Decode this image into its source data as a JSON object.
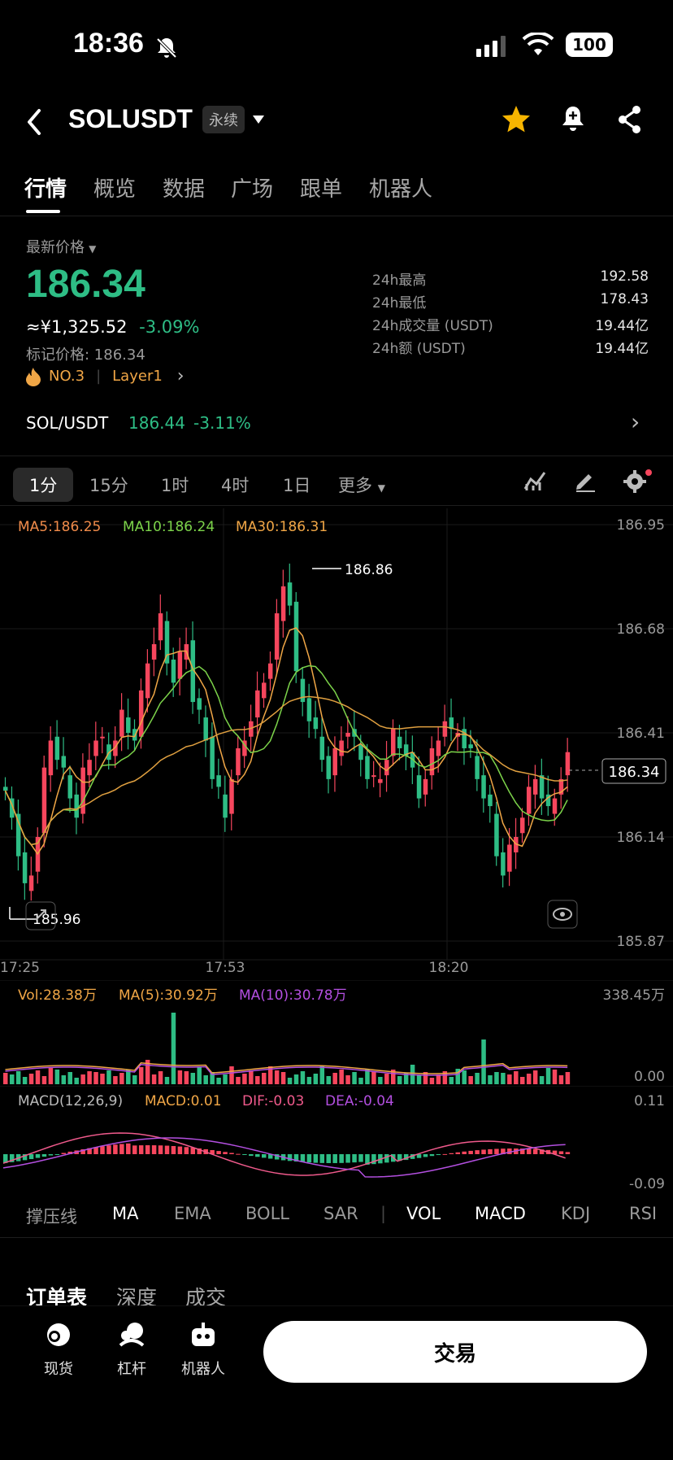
{
  "status_bar": {
    "time": "18:36",
    "battery": "100"
  },
  "header": {
    "symbol": "SOLUSDT",
    "contract_type": "永续"
  },
  "tabs": [
    {
      "label": "行情",
      "active": true
    },
    {
      "label": "概览",
      "active": false
    },
    {
      "label": "数据",
      "active": false
    },
    {
      "label": "广场",
      "active": false
    },
    {
      "label": "跟单",
      "active": false
    },
    {
      "label": "机器人",
      "active": false
    }
  ],
  "price": {
    "label": "最新价格",
    "last": "186.34",
    "cny": "≈¥1,325.52",
    "change": "-3.09%",
    "mark_label": "标记价格: 186.34",
    "rank": "NO.3",
    "sector": "Layer1"
  },
  "stats": [
    {
      "key": "24h最高",
      "value": "192.58"
    },
    {
      "key": "24h最低",
      "value": "178.43"
    },
    {
      "key": "24h成交量 (USDT)",
      "value": "19.44亿"
    },
    {
      "key": "24h额 (USDT)",
      "value": "19.44亿"
    }
  ],
  "spot_pair": {
    "pair": "SOL/USDT",
    "price": "186.44",
    "change": "-3.11%"
  },
  "intervals": [
    {
      "label": "1分",
      "active": true
    },
    {
      "label": "15分",
      "active": false
    },
    {
      "label": "1时",
      "active": false
    },
    {
      "label": "4时",
      "active": false
    },
    {
      "label": "1日",
      "active": false
    },
    {
      "label": "更多",
      "active": false
    }
  ],
  "colors": {
    "up": "#2ebd85",
    "down": "#f6465d",
    "ma5": "#f0a646",
    "ma10": "#7cd34a",
    "ma30": "#f0a646",
    "macd_dea": "#b34fe0"
  },
  "chart_data": {
    "type": "candlestick",
    "ma_legend": {
      "ma5": "MA5:186.25",
      "ma10": "MA10:186.24",
      "ma30": "MA30:186.31"
    },
    "y_ticks": [
      "186.95",
      "186.68",
      "186.41",
      "186.14",
      "185.87"
    ],
    "ylim": [
      185.87,
      186.95
    ],
    "x_ticks": [
      "17:25",
      "17:53",
      "18:20"
    ],
    "high_marker": "186.86",
    "low_marker": "185.96",
    "current_price": "186.34",
    "volume": {
      "legend": {
        "vol": "Vol:28.38万",
        "ma5": "MA(5):30.92万",
        "ma10": "MA(10):30.78万"
      },
      "y_ticks": [
        "338.45万",
        "0.00"
      ]
    },
    "macd": {
      "legend": {
        "name": "MACD(12,26,9)",
        "macd": "MACD:0.01",
        "dif": "DIF:-0.03",
        "dea": "DEA:-0.04"
      },
      "y_ticks": [
        "0.11",
        "-0.09"
      ]
    }
  },
  "indicators": [
    {
      "label": "撑压线",
      "on": false
    },
    {
      "label": "MA",
      "on": true
    },
    {
      "label": "EMA",
      "on": false
    },
    {
      "label": "BOLL",
      "on": false
    },
    {
      "label": "SAR",
      "on": false
    },
    {
      "label": "VOL",
      "on": true
    },
    {
      "label": "MACD",
      "on": true
    },
    {
      "label": "KDJ",
      "on": false
    },
    {
      "label": "RSI",
      "on": false
    }
  ],
  "orderbook_tabs": [
    {
      "label": "订单表",
      "active": true
    },
    {
      "label": "深度",
      "active": false
    },
    {
      "label": "成交",
      "active": false
    }
  ],
  "bottom_nav": [
    {
      "label": "现货",
      "icon": "spot-icon"
    },
    {
      "label": "杠杆",
      "icon": "margin-icon"
    },
    {
      "label": "机器人",
      "icon": "robot-icon"
    }
  ],
  "trade_button": "交易"
}
